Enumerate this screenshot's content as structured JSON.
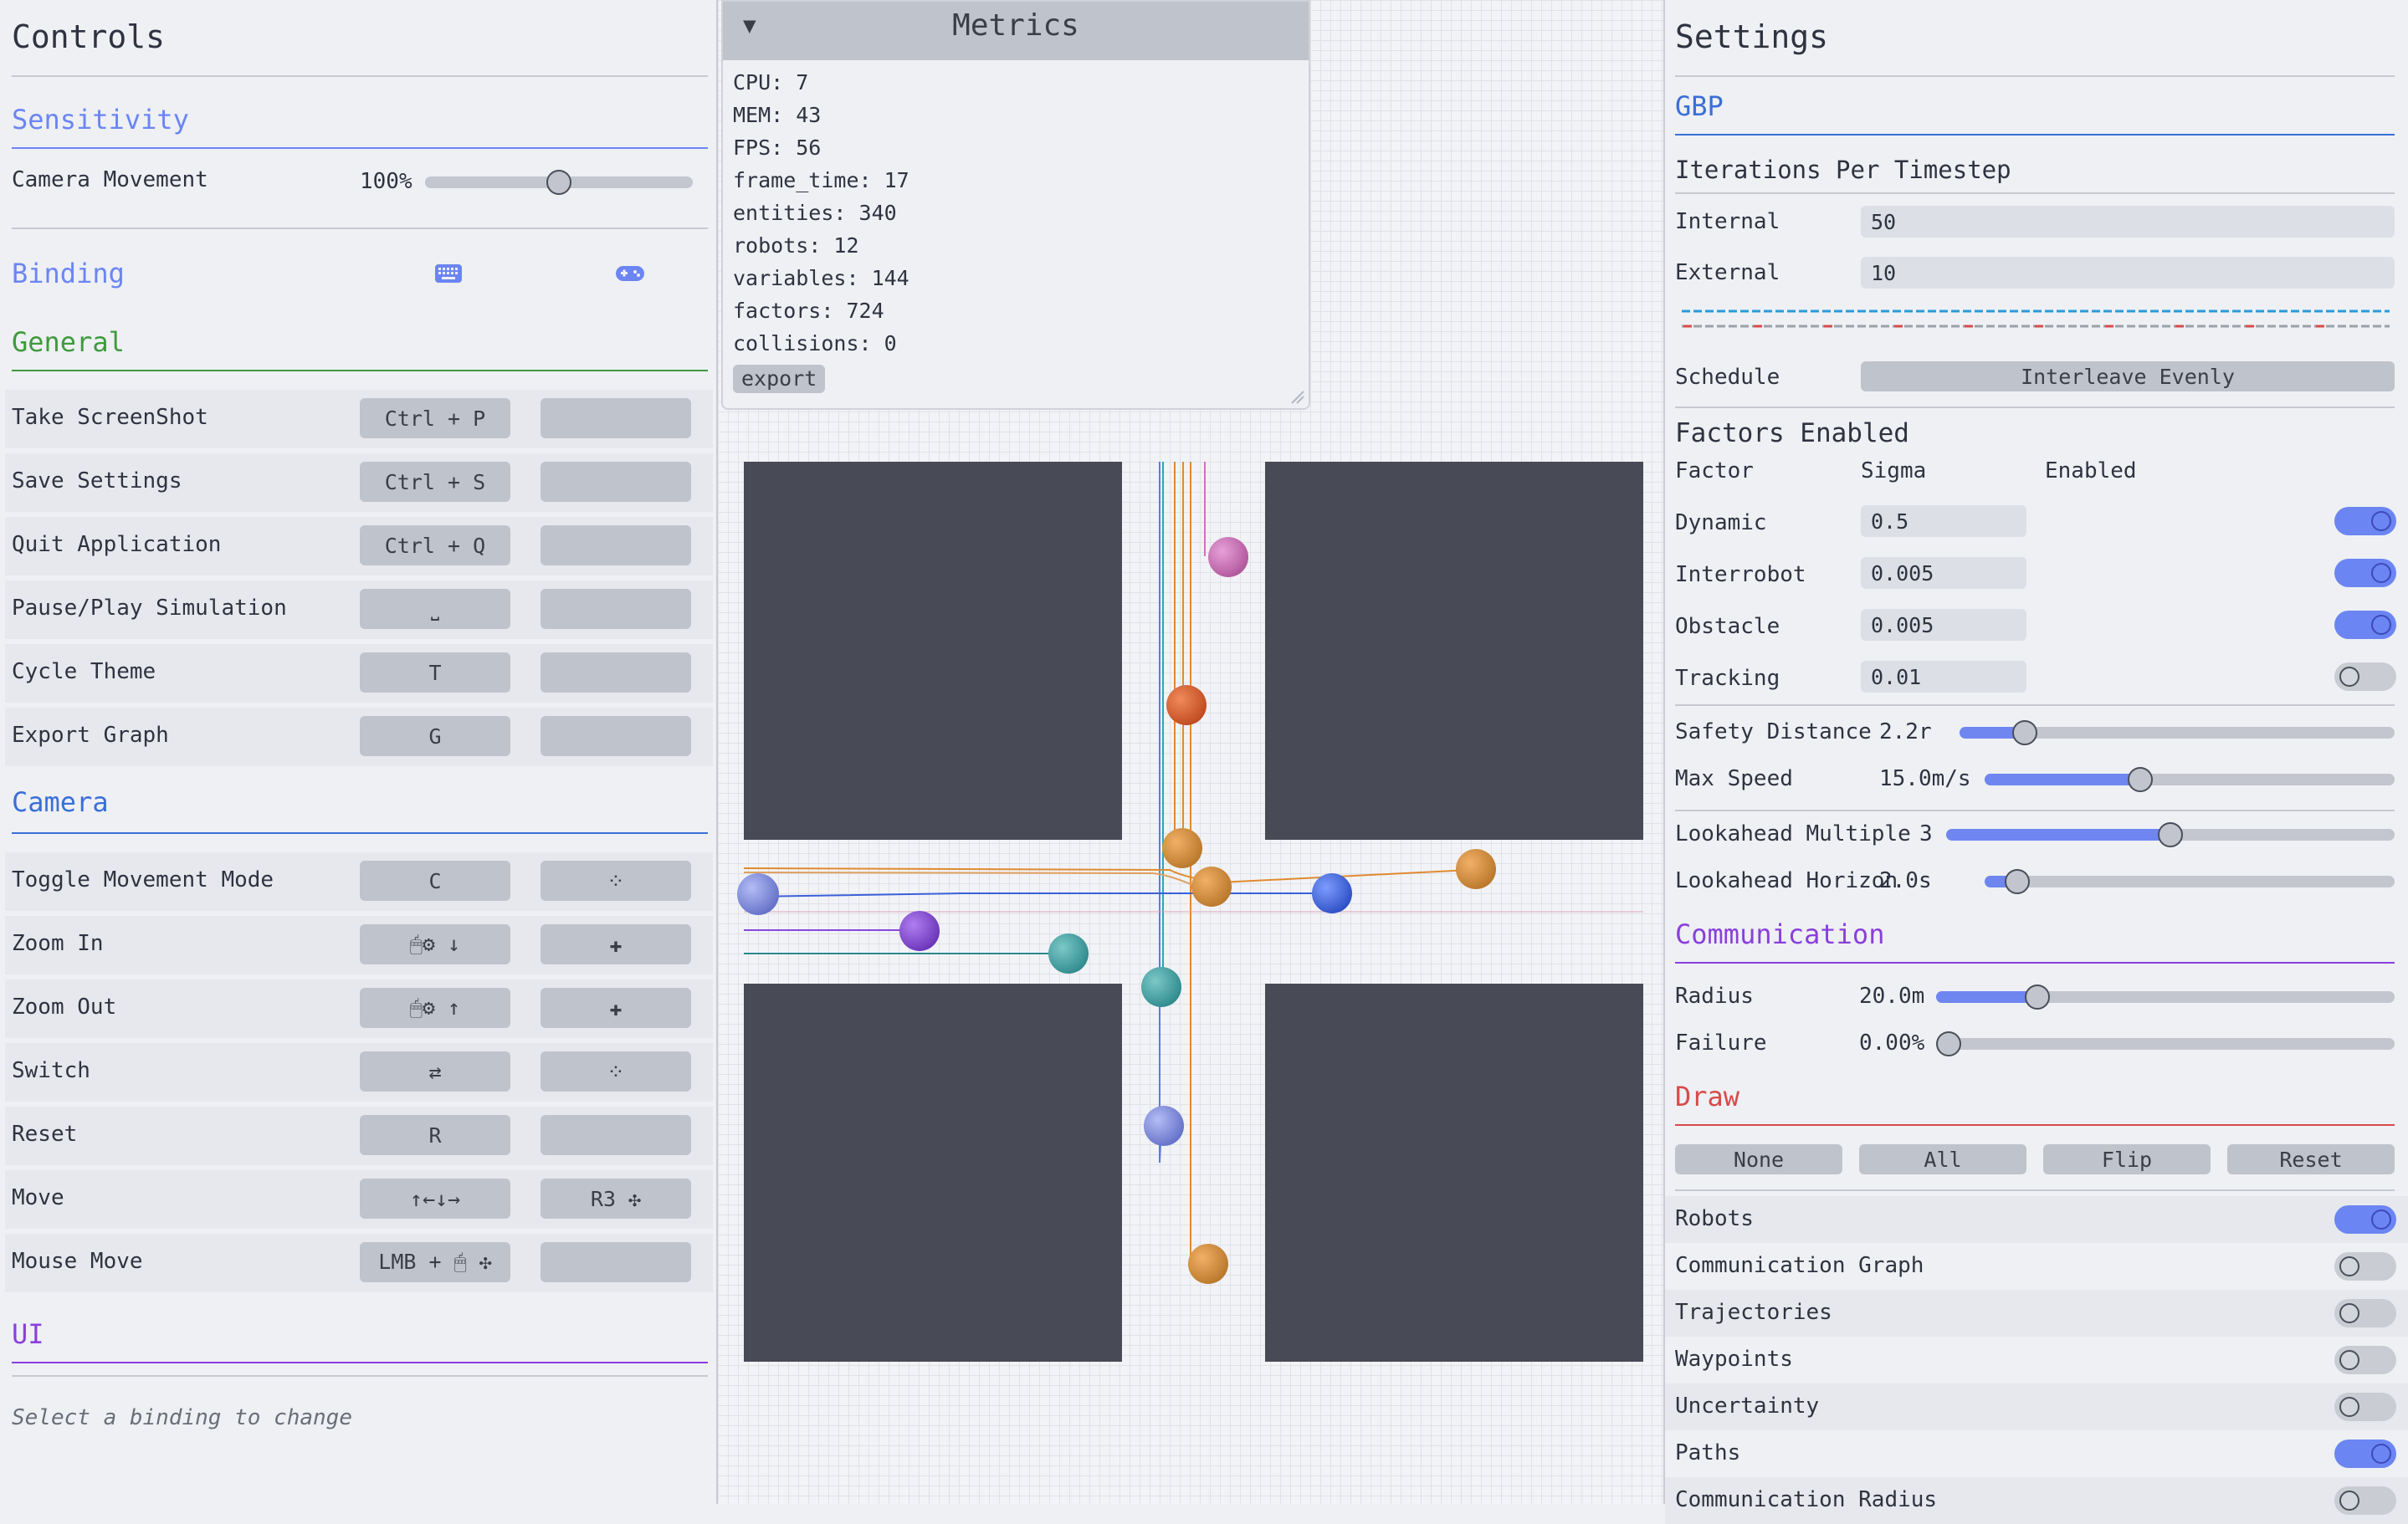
{
  "controls": {
    "title": "Controls",
    "sensitivity": {
      "title": "Sensitivity",
      "camera_movement_label": "Camera Movement",
      "camera_movement_value": "100%",
      "camera_movement_level": 0.5
    },
    "binding": {
      "title": "Binding",
      "keyboard_icon": "keyboard-icon",
      "gamepad_icon": "gamepad-icon"
    },
    "general": {
      "title": "General",
      "rows": [
        {
          "label": "Take ScreenShot",
          "key": "Ctrl + P",
          "pad": ""
        },
        {
          "label": "Save Settings",
          "key": "Ctrl + S",
          "pad": ""
        },
        {
          "label": "Quit Application",
          "key": "Ctrl + Q",
          "pad": ""
        },
        {
          "label": "Pause/Play Simulation",
          "key": "⎵",
          "pad": ""
        },
        {
          "label": "Cycle Theme",
          "key": "T",
          "pad": ""
        },
        {
          "label": "Export Graph",
          "key": "G",
          "pad": ""
        }
      ]
    },
    "camera": {
      "title": "Camera",
      "rows": [
        {
          "label": "Toggle Movement Mode",
          "key": "C",
          "pad": "⁘"
        },
        {
          "label": "Zoom In",
          "key": "🖱⚙ ↓",
          "pad": "✚"
        },
        {
          "label": "Zoom Out",
          "key": "🖱⚙ ↑",
          "pad": "✚"
        },
        {
          "label": "Switch",
          "key": "⇄",
          "pad": "⁘"
        },
        {
          "label": "Reset",
          "key": "R",
          "pad": ""
        },
        {
          "label": "Move",
          "key": "↑←↓→",
          "pad": "R3 ✣"
        },
        {
          "label": "Mouse Move",
          "key": "LMB + 🖱 ✣",
          "pad": ""
        }
      ]
    },
    "ui": {
      "title": "UI"
    },
    "hint": "Select a binding to change"
  },
  "metrics": {
    "title": "Metrics",
    "collapse_icon": "▼",
    "lines": [
      "CPU: 7",
      "MEM: 43",
      "FPS: 56",
      "frame_time: 17",
      "entities: 340",
      "robots: 12",
      "variables: 144",
      "factors: 724",
      "collisions: 0"
    ],
    "export_label": "export"
  },
  "settings": {
    "title": "Settings",
    "gbp": {
      "title": "GBP",
      "iterations_title": "Iterations Per Timestep",
      "internal_label": "Internal",
      "internal_value": "50",
      "external_label": "External",
      "external_value": "10",
      "schedule_label": "Schedule",
      "schedule_value": "Interleave Evenly"
    },
    "factors": {
      "title": "Factors Enabled",
      "col_factor": "Factor",
      "col_sigma": "Sigma",
      "col_enabled": "Enabled",
      "rows": [
        {
          "label": "Dynamic",
          "sigma": "0.5",
          "enabled": true
        },
        {
          "label": "Interrobot",
          "sigma": "0.005",
          "enabled": true
        },
        {
          "label": "Obstacle",
          "sigma": "0.005",
          "enabled": true
        },
        {
          "label": "Tracking",
          "sigma": "0.01",
          "enabled": false
        }
      ]
    },
    "sliders": [
      {
        "label": "Safety Distance",
        "value": "2.2r",
        "level": 0.15
      },
      {
        "label": "Max Speed",
        "value": "15.0m/s",
        "level": 0.38
      },
      {
        "label": "Lookahead Multiple",
        "value": "3",
        "level": 0.5
      },
      {
        "label": "Lookahead Horizon",
        "value": "2.0s",
        "level": 0.08
      }
    ],
    "communication": {
      "title": "Communication",
      "radius_label": "Radius",
      "radius_value": "20.0m",
      "radius_level": 0.22,
      "failure_label": "Failure",
      "failure_value": "0.00%",
      "failure_level": 0.0
    },
    "draw": {
      "title": "Draw",
      "buttons": [
        "None",
        "All",
        "Flip",
        "Reset"
      ],
      "toggles": [
        {
          "label": "Robots",
          "on": true
        },
        {
          "label": "Communication Graph",
          "on": false
        },
        {
          "label": "Trajectories",
          "on": false
        },
        {
          "label": "Waypoints",
          "on": false
        },
        {
          "label": "Uncertainty",
          "on": false
        },
        {
          "label": "Paths",
          "on": true
        },
        {
          "label": "Communication Radius",
          "on": false
        }
      ]
    }
  },
  "colors": {
    "accent_blue": "#6b85f2",
    "general_green": "#3f9a3c",
    "camera_blue": "#3a6fd6",
    "ui_purple": "#8a3fdc",
    "communication_purple": "#8a3fdc",
    "draw_red": "#d94a4a",
    "obstacle": "#484a55"
  }
}
